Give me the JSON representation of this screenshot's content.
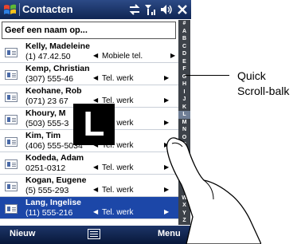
{
  "app": {
    "title": "Contacten",
    "status_icons": [
      "sync-icon",
      "signal-icon",
      "speaker-icon",
      "close-icon"
    ]
  },
  "search": {
    "placeholder": "Geef een naam op..."
  },
  "contacts": [
    {
      "name": "Kelly, Madeleine",
      "number": "(1) 47.42.50",
      "type": "Mobiele tel."
    },
    {
      "name": "Kemp, Christian",
      "number": "(307) 555-46",
      "type": "Tel. werk"
    },
    {
      "name": "Keohane, Rob",
      "number": "(071) 23 67",
      "type": "Tel. werk"
    },
    {
      "name": "Khoury, M",
      "number": "(503) 555-3",
      "type": "Tel. werk"
    },
    {
      "name": "Kim, Tim",
      "number": "(406) 555-5034",
      "type": "Tel. werk"
    },
    {
      "name": "Kodeda, Adam",
      "number": "0251-0312",
      "type": "Tel. werk"
    },
    {
      "name": "Kogan, Eugene",
      "number": "(5) 555-293",
      "type": "Tel. werk"
    },
    {
      "name": "Lang, Ingelise",
      "number": "(11) 555-216",
      "type": "Tel. werk",
      "selected": true
    }
  ],
  "alphabet": [
    "#",
    "A",
    "B",
    "C",
    "D",
    "E",
    "F",
    "G",
    "H",
    "I",
    "J",
    "K",
    "L",
    "M",
    "N",
    "O",
    "P",
    "Q",
    "R",
    "S",
    "T",
    "U",
    "V",
    "W",
    "X",
    "Y",
    "Z"
  ],
  "alphabet_selected": "L",
  "big_letter": "L",
  "softkeys": {
    "left": "Nieuw",
    "right": "Menu"
  },
  "callout": {
    "line1": "Quick",
    "line2": "Scroll-balk"
  },
  "colors": {
    "title_bar": "#0f2552",
    "selected_row": "#1c47a8",
    "scroll_bar": "#3d4249"
  }
}
